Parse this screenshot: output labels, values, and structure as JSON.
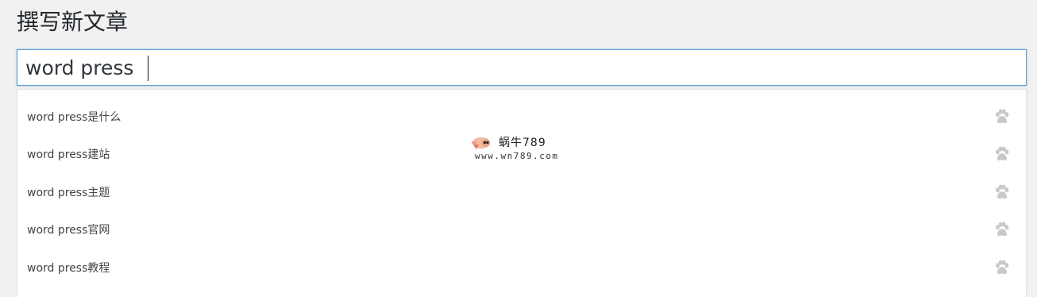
{
  "page": {
    "title": "撰写新文章"
  },
  "title_field": {
    "value": "word press"
  },
  "suggestions": [
    {
      "label": "word press是什么",
      "icon": "paw-icon"
    },
    {
      "label": "word press建站",
      "icon": "paw-icon"
    },
    {
      "label": "word press主题",
      "icon": "paw-icon"
    },
    {
      "label": "word press官网",
      "icon": "paw-icon"
    },
    {
      "label": "word press教程",
      "icon": "paw-icon"
    }
  ],
  "watermark": {
    "name": "蜗牛789",
    "url": "www.wn789.com"
  },
  "colors": {
    "background": "#f1f1f1",
    "focus_border": "#5b9dd9",
    "paw_icon": "#c8c8c8",
    "text": "#444444"
  }
}
